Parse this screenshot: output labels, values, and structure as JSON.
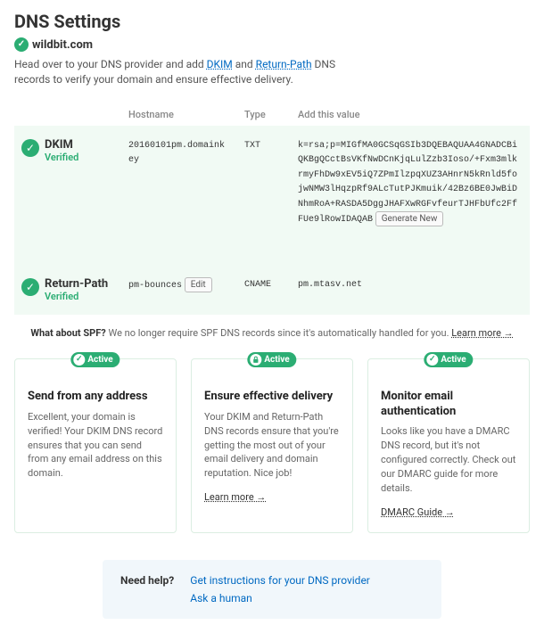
{
  "title": "DNS Settings",
  "domain": "wildbit.com",
  "instruction": "Head over to your DNS provider and add DKIM and Return-Path DNS records to verify your domain and ensure effective delivery.",
  "dkim_term": "DKIM",
  "return_path_term": "Return-Path",
  "columns": {
    "hostname": "Hostname",
    "type": "Type",
    "value": "Add this value"
  },
  "records": {
    "dkim": {
      "name": "DKIM",
      "status": "Verified",
      "hostname": "20160101pm.domainkey",
      "type": "TXT",
      "value": "k=rsa;p=MIGfMA0GCSqGSIb3DQEBAQUAA4GNADCBiQKBgQCctBsVKfNwDCnKjqLulZzb3Ioso/+Fxm3mlkrmyFhDw9xEV5iQ7ZPmIlzpqXUZ3AHnrN5kRnld5fojwNMW3lHqzpRf9ALcTutPJKmuik/42Bz6BE0JwBiDNhmRoA+RASDA5DggJHAFXwRGFvfeurTJHFbUfc2FfFUe9lRowIDAQAB",
      "button": "Generate New"
    },
    "return_path": {
      "name": "Return-Path",
      "status": "Verified",
      "hostname": "pm-bounces",
      "type": "CNAME",
      "value": "pm.mtasv.net",
      "button": "Edit"
    }
  },
  "spf": {
    "label": "What about SPF?",
    "text": " We no longer require SPF DNS records since it's automatically handled for you. ",
    "link": "Learn more →"
  },
  "active_label": "Active",
  "cards": {
    "send": {
      "title": "Send from any address",
      "body": "Excellent, your domain is verified! Your DKIM DNS record ensures that you can send from any email address on this domain."
    },
    "delivery": {
      "title": "Ensure effective delivery",
      "body": "Your DKIM and Return-Path DNS records ensure that you're getting the most out of your email delivery and domain reputation. Nice job!",
      "link": "Learn more →"
    },
    "dmarc": {
      "title": "Monitor email authentication",
      "body": "Looks like you have a DMARC DNS record, but it's not configured correctly. Check out our DMARC guide for more details.",
      "link": "DMARC Guide →"
    }
  },
  "help": {
    "label": "Need help?",
    "links": {
      "provider": "Get instructions for your DNS provider",
      "human": "Ask a human"
    }
  }
}
